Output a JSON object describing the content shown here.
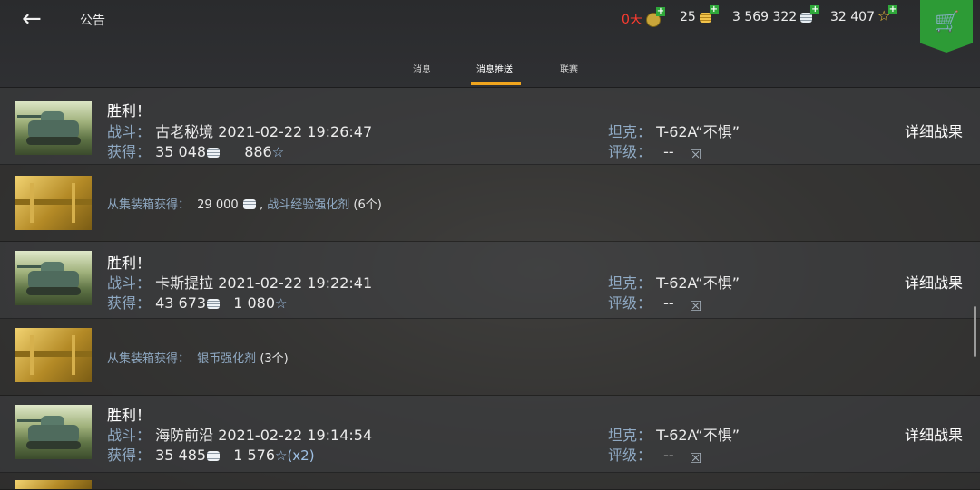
{
  "header": {
    "back_icon": "arrow-left-icon",
    "title": "公告",
    "resources": {
      "premium_days": "0天",
      "gold": "25",
      "credits": "3 569 322",
      "free_xp": "32 407"
    },
    "colors": {
      "premium_days": "#ff3b30",
      "cart_bg": "#2d9b36",
      "tab_underline": "#f0a51e"
    }
  },
  "tabs": [
    {
      "label": "消息",
      "active": false
    },
    {
      "label": "消息推送",
      "active": true
    },
    {
      "label": "联赛",
      "active": false
    }
  ],
  "messages": [
    {
      "type": "battle",
      "title": "胜利！",
      "battle_label": "战斗：",
      "map_time": "古老秘境 2021-02-22 19:26:47",
      "earned_label": "获得：",
      "credits": "35 048",
      "xp": "886",
      "xp_suffix": "",
      "tank_label": "坦克：",
      "tank": "T-62A“不惧”",
      "rating_label": "评级：",
      "rating": "--",
      "detail_label": "详细战果"
    },
    {
      "type": "crate",
      "prefix": "从集装箱获得：",
      "credits": "29 000",
      "separator": ",",
      "item": "战斗经验强化剂",
      "count": "(6个)"
    },
    {
      "type": "battle",
      "title": "胜利！",
      "battle_label": "战斗：",
      "map_time": "卡斯提拉 2021-02-22 19:22:41",
      "earned_label": "获得：",
      "credits": "43 673",
      "xp": "1 080",
      "xp_suffix": "",
      "tank_label": "坦克：",
      "tank": "T-62A“不惧”",
      "rating_label": "评级：",
      "rating": "--",
      "detail_label": "详细战果"
    },
    {
      "type": "crate",
      "prefix": "从集装箱获得：",
      "item": "银币强化剂",
      "count": "(3个)"
    },
    {
      "type": "battle",
      "title": "胜利！",
      "battle_label": "战斗：",
      "map_time": "海防前沿 2021-02-22 19:14:54",
      "earned_label": "获得：",
      "credits": "35 485",
      "xp": "1 576",
      "xp_suffix": "(x2)",
      "tank_label": "坦克：",
      "tank": "T-62A“不惧”",
      "rating_label": "评级：",
      "rating": "--",
      "detail_label": "详细战果"
    }
  ]
}
